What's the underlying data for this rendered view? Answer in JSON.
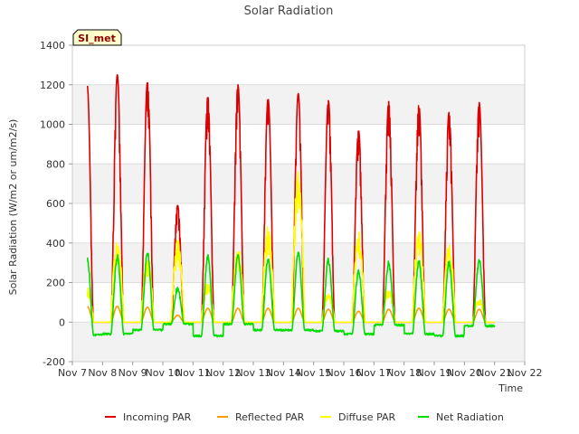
{
  "chart_data": {
    "type": "line",
    "title": "Solar Radiation",
    "xlabel": "Time",
    "ylabel": "Solar Radiation (W/m2 or um/m2/s)",
    "ylim": [
      -200,
      1400
    ],
    "yticks": [
      -200,
      0,
      200,
      400,
      600,
      800,
      1000,
      1200,
      1400
    ],
    "xlim": [
      7,
      22
    ],
    "xticks": [
      {
        "value": 7,
        "label": "Nov 7"
      },
      {
        "value": 8,
        "label": "Nov 8"
      },
      {
        "value": 9,
        "label": "Nov 9"
      },
      {
        "value": 10,
        "label": "Nov 10"
      },
      {
        "value": 11,
        "label": "Nov 11"
      },
      {
        "value": 12,
        "label": "Nov 12"
      },
      {
        "value": 13,
        "label": "Nov 13"
      },
      {
        "value": 14,
        "label": "Nov 14"
      },
      {
        "value": 15,
        "label": "Nov 15"
      },
      {
        "value": 16,
        "label": "Nov 16"
      },
      {
        "value": 17,
        "label": "Nov 17"
      },
      {
        "value": 18,
        "label": "Nov 18"
      },
      {
        "value": 19,
        "label": "Nov 19"
      },
      {
        "value": 20,
        "label": "Nov 20"
      },
      {
        "value": 21,
        "label": "Nov 21"
      },
      {
        "value": 22,
        "label": "Nov 22"
      }
    ],
    "grid": true,
    "legend_position": "bottom",
    "station_label": "SI_met",
    "day_start": 7.5,
    "day_end": 21.0,
    "daylight": [
      0.28,
      0.7
    ],
    "days": [
      {
        "noon": 7.5,
        "incoming": 1200,
        "reflected": 80,
        "diffuse": 180,
        "net": 325,
        "night": -65
      },
      {
        "noon": 8.5,
        "incoming": 1250,
        "reflected": 80,
        "diffuse": 420,
        "net": 330,
        "night": -60
      },
      {
        "noon": 9.5,
        "incoming": 1215,
        "reflected": 75,
        "diffuse": 330,
        "net": 350,
        "night": -40
      },
      {
        "noon": 10.5,
        "incoming": 590,
        "reflected": 35,
        "diffuse": 420,
        "net": 170,
        "night": -10
      },
      {
        "noon": 11.5,
        "incoming": 1140,
        "reflected": 70,
        "diffuse": 200,
        "net": 330,
        "night": -70
      },
      {
        "noon": 12.5,
        "incoming": 1200,
        "reflected": 70,
        "diffuse": 380,
        "net": 330,
        "night": -10
      },
      {
        "noon": 13.5,
        "incoming": 1130,
        "reflected": 70,
        "diffuse": 490,
        "net": 310,
        "night": -40
      },
      {
        "noon": 14.5,
        "incoming": 1155,
        "reflected": 70,
        "diffuse": 780,
        "net": 345,
        "night": -40
      },
      {
        "noon": 15.5,
        "incoming": 1120,
        "reflected": 65,
        "diffuse": 150,
        "net": 310,
        "night": -45
      },
      {
        "noon": 16.5,
        "incoming": 970,
        "reflected": 55,
        "diffuse": 460,
        "net": 255,
        "night": -60
      },
      {
        "noon": 17.5,
        "incoming": 1115,
        "reflected": 65,
        "diffuse": 170,
        "net": 295,
        "night": -15
      },
      {
        "noon": 18.5,
        "incoming": 1100,
        "reflected": 70,
        "diffuse": 480,
        "net": 305,
        "night": -60
      },
      {
        "noon": 19.5,
        "incoming": 1060,
        "reflected": 65,
        "diffuse": 400,
        "net": 300,
        "night": -70
      },
      {
        "noon": 20.5,
        "incoming": 1110,
        "reflected": 65,
        "diffuse": 120,
        "net": 310,
        "night": -20
      }
    ],
    "series": [
      {
        "name": "Incoming PAR",
        "key": "incoming",
        "color": "#dd0000"
      },
      {
        "name": "Reflected PAR",
        "key": "reflected",
        "color": "#ff9900"
      },
      {
        "name": "Diffuse PAR",
        "key": "diffuse",
        "color": "#ffff00"
      },
      {
        "name": "Net Radiation",
        "key": "net",
        "color": "#00dd00"
      }
    ]
  }
}
